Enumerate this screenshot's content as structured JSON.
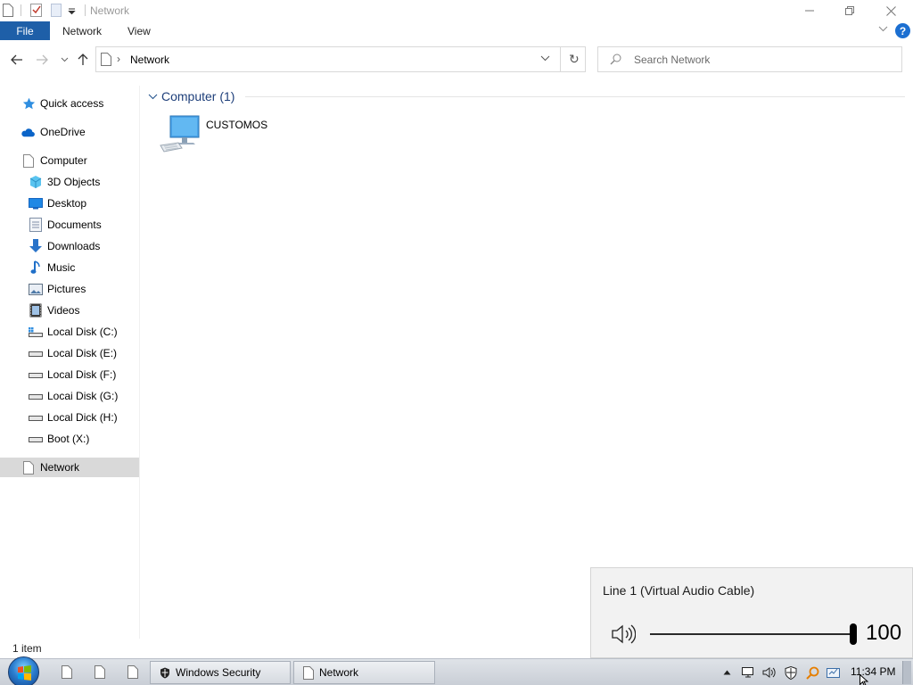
{
  "window": {
    "title": "Network",
    "controls": {
      "minimize": "minimize",
      "restore": "restore",
      "close": "close"
    }
  },
  "ribbon": {
    "file_tab": "File",
    "tabs": [
      "Network",
      "View"
    ]
  },
  "address": {
    "path": "Network",
    "search_placeholder": "Search Network"
  },
  "nav": {
    "quick_access": "Quick access",
    "onedrive": "OneDrive",
    "computer": "Computer",
    "items": [
      {
        "label": "3D Objects",
        "icon": "cube-icon"
      },
      {
        "label": "Desktop",
        "icon": "desktop-icon"
      },
      {
        "label": "Documents",
        "icon": "documents-icon"
      },
      {
        "label": "Downloads",
        "icon": "download-arrow-icon"
      },
      {
        "label": "Music",
        "icon": "music-note-icon"
      },
      {
        "label": "Pictures",
        "icon": "pictures-icon"
      },
      {
        "label": "Videos",
        "icon": "film-icon"
      },
      {
        "label": "Local Disk (C:)",
        "icon": "system-drive-icon"
      },
      {
        "label": "Local Disk (E:)",
        "icon": "drive-icon"
      },
      {
        "label": "Local Disk (F:)",
        "icon": "drive-icon"
      },
      {
        "label": "Locai Disk (G:)",
        "icon": "drive-icon"
      },
      {
        "label": "Local Dick (H:)",
        "icon": "drive-icon"
      },
      {
        "label": "Boot (X:)",
        "icon": "drive-icon"
      }
    ],
    "network": "Network"
  },
  "content": {
    "group_title": "Computer (1)",
    "computers": [
      {
        "name": "CUSTOMOS"
      }
    ]
  },
  "status": {
    "item_count": "1 item"
  },
  "volume_flyout": {
    "device": "Line 1 (Virtual Audio Cable)",
    "level": 100,
    "level_text": "100"
  },
  "taskbar": {
    "tasks": [
      {
        "label": "Windows Security"
      },
      {
        "label": "Network"
      }
    ],
    "clock": "11:34 PM"
  },
  "colors": {
    "file_tab": "#1e5fa8",
    "selected_nav": "#d9d9d9",
    "group_title": "#1e3f7a"
  }
}
